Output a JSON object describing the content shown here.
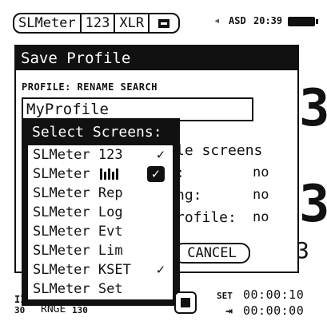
{
  "statusbar": {
    "tabs": [
      "SLMeter",
      "123",
      "XLR"
    ],
    "mode": "ASD",
    "time": "20:39"
  },
  "background": {
    "digit_top": "3",
    "digit_mid": "3",
    "digit_bottom": "3",
    "range_left": "30",
    "range_label": "RNGE",
    "range_value": "130",
    "left_marker": "II"
  },
  "save_dialog": {
    "title": "Save Profile",
    "caption": "PROFILE: RENAME SEARCH",
    "input_value": "MyProfile",
    "options": [
      {
        "label": "le screens",
        "value": ""
      },
      {
        "label": ":",
        "value": "no"
      },
      {
        "label": "ng:",
        "value": "no"
      },
      {
        "label": "rofile:",
        "value": "no"
      }
    ],
    "cancel_label": "CANCEL"
  },
  "select_screens": {
    "title": "Select Screens:",
    "items": [
      {
        "prefix": "SLMeter",
        "suffix": "123",
        "check": "✓",
        "checked": true,
        "boxed": false,
        "bars": false
      },
      {
        "prefix": "SLMeter",
        "suffix": "",
        "check": "✓",
        "checked": true,
        "boxed": true,
        "bars": true
      },
      {
        "prefix": "SLMeter",
        "suffix": "Rep",
        "check": "",
        "checked": false,
        "boxed": false,
        "bars": false
      },
      {
        "prefix": "SLMeter",
        "suffix": "Log",
        "check": "",
        "checked": false,
        "boxed": false,
        "bars": false
      },
      {
        "prefix": "SLMeter",
        "suffix": "Evt",
        "check": "",
        "checked": false,
        "boxed": false,
        "bars": false
      },
      {
        "prefix": "SLMeter",
        "suffix": "Lim",
        "check": "",
        "checked": false,
        "boxed": false,
        "bars": false
      },
      {
        "prefix": "SLMeter",
        "suffix": "KSET",
        "check": "✓",
        "checked": true,
        "boxed": false,
        "bars": false
      },
      {
        "prefix": "SLMeter",
        "suffix": "Set",
        "check": "",
        "checked": false,
        "boxed": false,
        "bars": false
      }
    ]
  },
  "bottom": {
    "set_label": "SET",
    "set_time": "00:00:10",
    "elapsed_symbol": "⇥",
    "elapsed_time": "00:00:00"
  }
}
